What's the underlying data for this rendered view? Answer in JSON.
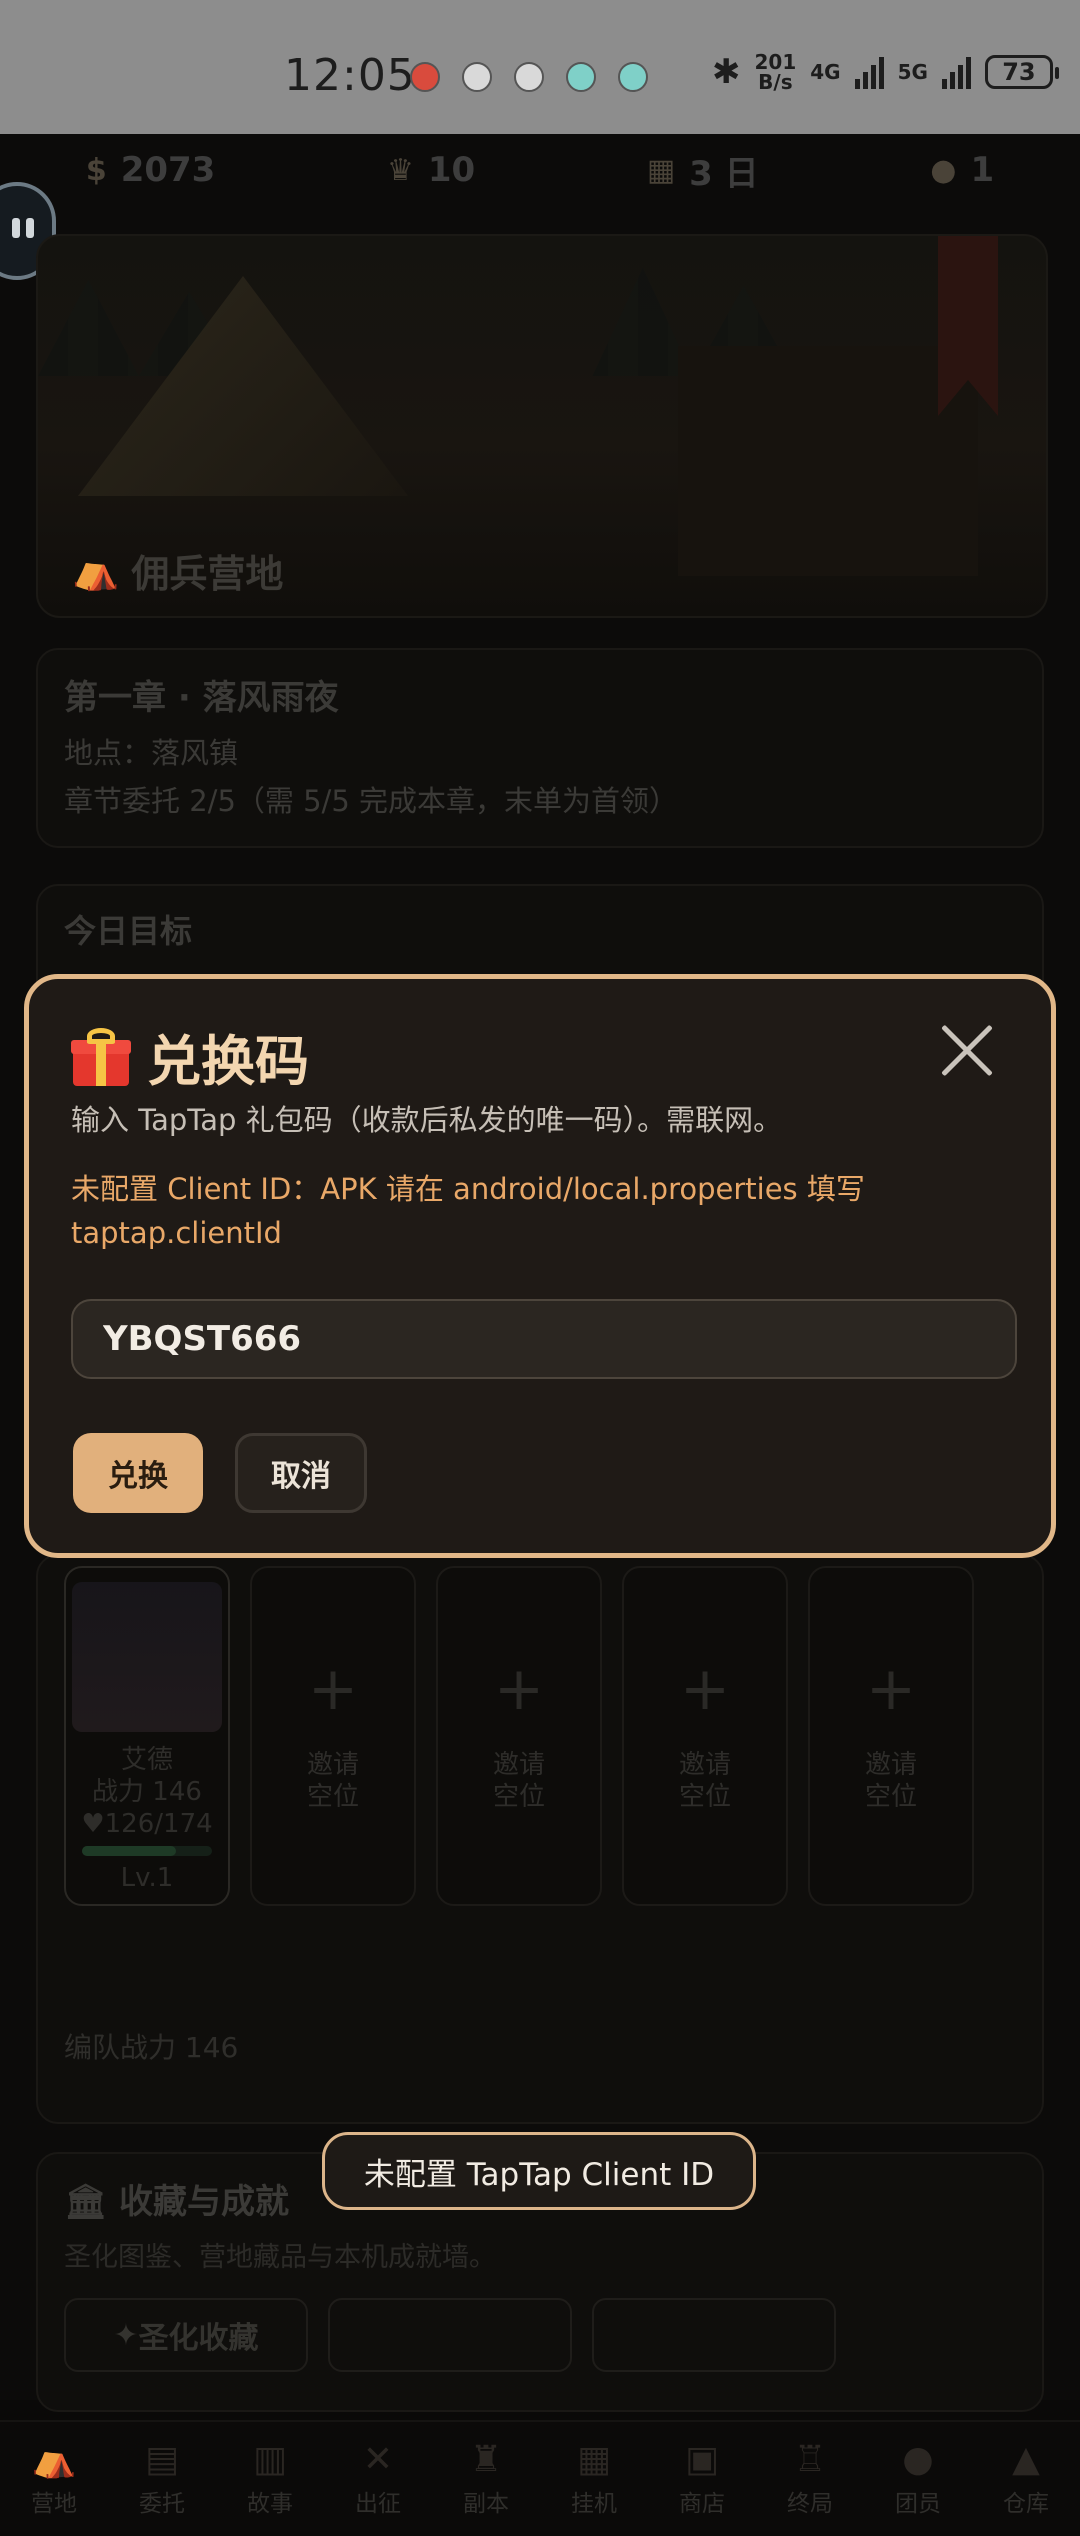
{
  "status_bar": {
    "time": "12:05",
    "net_speed_top": "201",
    "net_speed_bottom": "B/s",
    "net1": "4G",
    "net2": "5G",
    "battery": "73"
  },
  "resources": {
    "gold": "2073",
    "crown": "10",
    "day": "3 日",
    "members": "1"
  },
  "banner": {
    "title": "佣兵营地"
  },
  "chapter": {
    "title": "第一章 · 落风雨夜",
    "location": "地点：落风镇",
    "progress": "章节委托 2/5（需 5/5 完成本章，末单为首领）"
  },
  "goals": {
    "title": "今日目标"
  },
  "team": {
    "hero_name": "艾德",
    "hero_power": "战力 146",
    "hero_hp": "126/174",
    "hero_hp_fraction": 0.72,
    "hero_level": "Lv.1",
    "empty_slot_label_1": "邀请",
    "empty_slot_label_2": "空位",
    "team_power": "编队战力 146"
  },
  "collection": {
    "title": "收藏与成就",
    "desc": "圣化图鉴、营地藏品与本机成就墙。",
    "button_1": "圣化收藏"
  },
  "tabs": [
    {
      "label": "营地",
      "icon": "camp-icon"
    },
    {
      "label": "委托",
      "icon": "scroll-icon"
    },
    {
      "label": "故事",
      "icon": "book-icon"
    },
    {
      "label": "出征",
      "icon": "swords-icon"
    },
    {
      "label": "副本",
      "icon": "castle-icon"
    },
    {
      "label": "挂机",
      "icon": "map-icon"
    },
    {
      "label": "商店",
      "icon": "shop-icon"
    },
    {
      "label": "终局",
      "icon": "tower-icon"
    },
    {
      "label": "团员",
      "icon": "member-icon"
    },
    {
      "label": "仓库",
      "icon": "bag-icon"
    }
  ],
  "dialog": {
    "title": "兑换码",
    "description": "输入 TapTap 礼包码（收款后私发的唯一码）。需联网。",
    "warning": "未配置 Client ID：APK 请在 android/local.properties 填写 taptap.clientId",
    "input_value": "YBQST666",
    "confirm_label": "兑换",
    "cancel_label": "取消"
  },
  "toast": {
    "message": "未配置 TapTap Client ID"
  },
  "colors": {
    "accent": "#e1b07c",
    "dialog_border": "#e1b788",
    "warning_text": "#e9a868",
    "dialog_bg": "#1f1a16"
  }
}
